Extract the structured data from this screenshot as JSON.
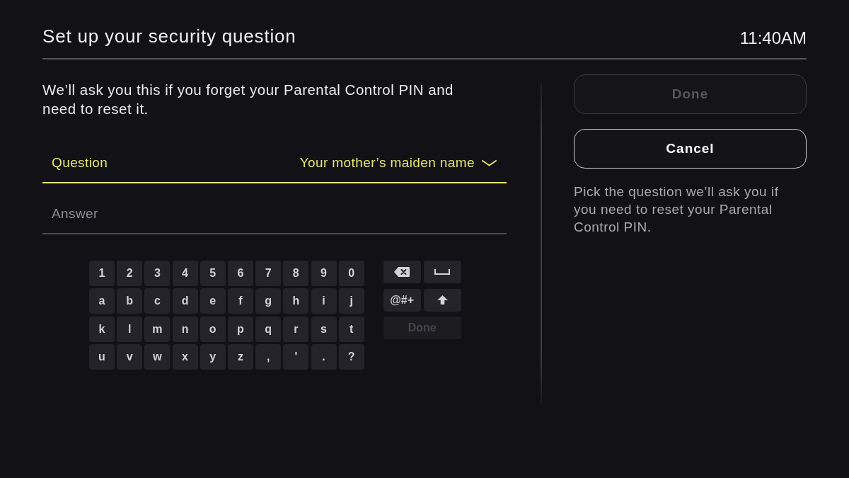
{
  "header": {
    "title": "Set up your security question",
    "time": "11:40AM"
  },
  "description": "We’ll ask you this if you forget your Parental Control PIN and need to reset it.",
  "fields": [
    {
      "kind": "dropdown",
      "label": "Question",
      "value": "Your mother’s maiden name",
      "focused": true
    },
    {
      "kind": "text",
      "placeholder": "Answer",
      "focused": false
    }
  ],
  "keyboard": {
    "rows": [
      [
        "1",
        "2",
        "3",
        "4",
        "5",
        "6",
        "7",
        "8",
        "9",
        "0"
      ],
      [
        "a",
        "b",
        "c",
        "d",
        "e",
        "f",
        "g",
        "h",
        "i",
        "j"
      ],
      [
        "k",
        "l",
        "m",
        "n",
        "o",
        "p",
        "q",
        "r",
        "s",
        "t"
      ],
      [
        "u",
        "v",
        "w",
        "x",
        "y",
        "z",
        ",",
        "'",
        ".",
        "?"
      ]
    ],
    "actions": [
      {
        "kind": "backspace",
        "disabled": false
      },
      {
        "kind": "space",
        "disabled": false
      },
      {
        "kind": "symbols",
        "label": "@#+",
        "disabled": false
      },
      {
        "kind": "shift",
        "disabled": false
      },
      {
        "kind": "done",
        "label": "Done",
        "disabled": true
      }
    ]
  },
  "buttons": [
    {
      "label": "Done",
      "disabled": true
    },
    {
      "label": "Cancel",
      "disabled": false
    }
  ],
  "help": "Pick the question we’ll ask you if you need to reset your Parental Control PIN."
}
